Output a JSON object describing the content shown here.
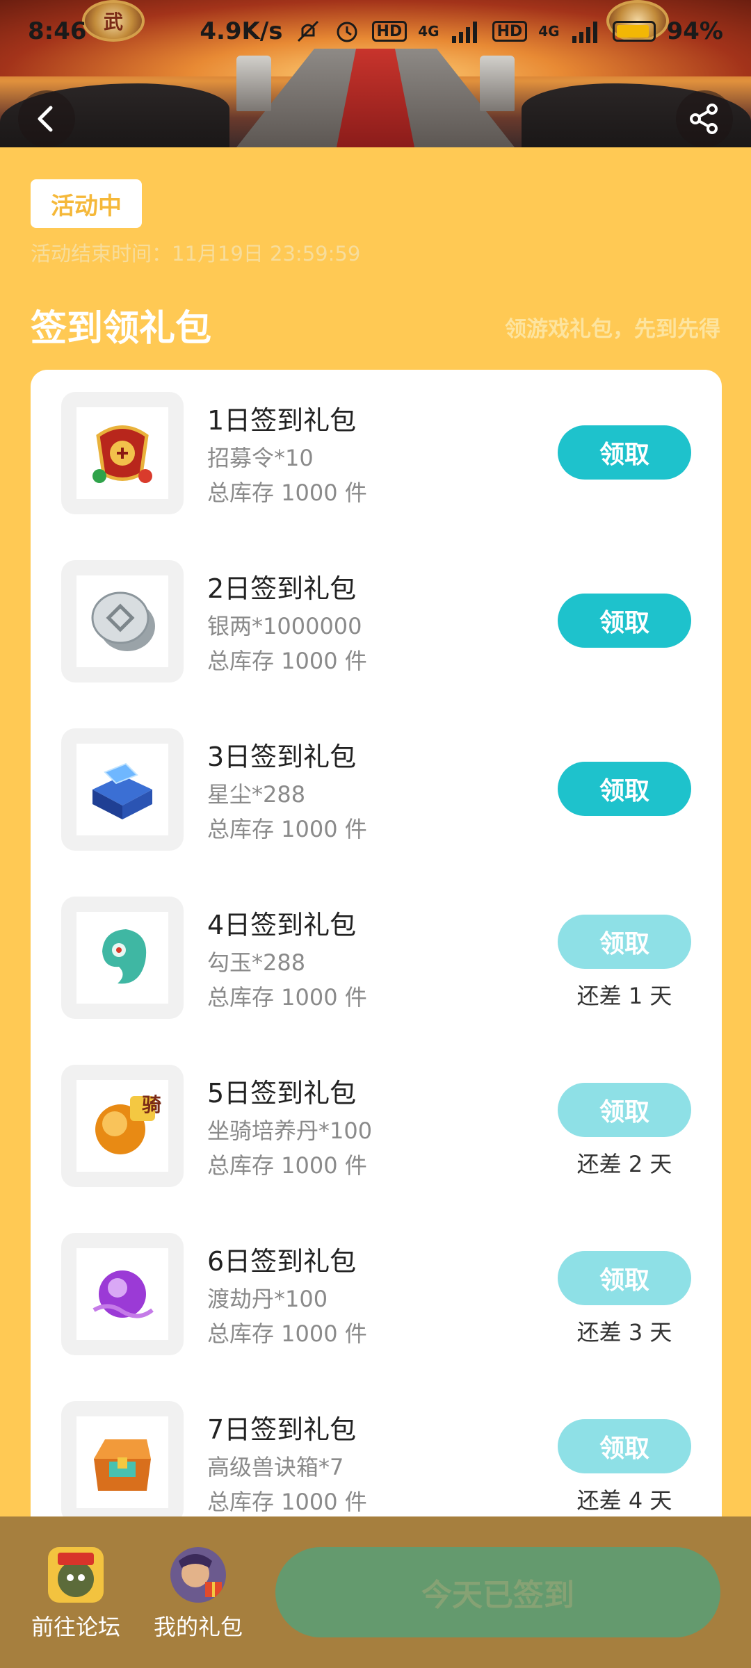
{
  "status_bar": {
    "time": "8:46",
    "speed": "4.9K/s",
    "hd1": "HD",
    "net1": "4G",
    "hd2": "HD",
    "net2": "4G",
    "battery": "94%",
    "battery_level": 0.94
  },
  "activity": {
    "status": "活动中",
    "end_time": "活动结束时间：11月19日 23:59:59"
  },
  "section": {
    "title": "签到领礼包",
    "subtitle": "领游戏礼包，先到先得"
  },
  "gifts": [
    {
      "title": "1日签到礼包",
      "item": "招募令*10",
      "stock": "总库存 1000 件",
      "button": "领取",
      "remain": "",
      "icon": "recruit-token-icon"
    },
    {
      "title": "2日签到礼包",
      "item": "银两*1000000",
      "stock": "总库存 1000 件",
      "button": "领取",
      "remain": "",
      "icon": "silver-coin-icon"
    },
    {
      "title": "3日签到礼包",
      "item": "星尘*288",
      "stock": "总库存 1000 件",
      "button": "领取",
      "remain": "",
      "icon": "stardust-chest-icon"
    },
    {
      "title": "4日签到礼包",
      "item": "勾玉*288",
      "stock": "总库存 1000 件",
      "button": "领取",
      "remain": "还差 1 天",
      "icon": "magatama-icon"
    },
    {
      "title": "5日签到礼包",
      "item": "坐骑培养丹*100",
      "stock": "总库存 1000 件",
      "button": "领取",
      "remain": "还差 2 天",
      "icon": "mount-pill-icon"
    },
    {
      "title": "6日签到礼包",
      "item": "渡劫丹*100",
      "stock": "总库存 1000 件",
      "button": "领取",
      "remain": "还差 3 天",
      "icon": "tribulation-pill-icon"
    },
    {
      "title": "7日签到礼包",
      "item": "高级兽诀箱*7",
      "stock": "总库存 1000 件",
      "button": "领取",
      "remain": "还差 4 天",
      "icon": "beast-chest-icon"
    }
  ],
  "bottom": {
    "forum_label": "前往论坛",
    "my_gifts_label": "我的礼包",
    "signed_label": "今天已签到"
  },
  "badge_glyph": "骑",
  "banner_glyph": "武",
  "colors": {
    "background": "#FFC954",
    "accent_button": "#1ec2cc",
    "disabled_button": "#8ee0e6",
    "bottom_bar": "#a67f3e",
    "signed_button": "#649a6e"
  }
}
